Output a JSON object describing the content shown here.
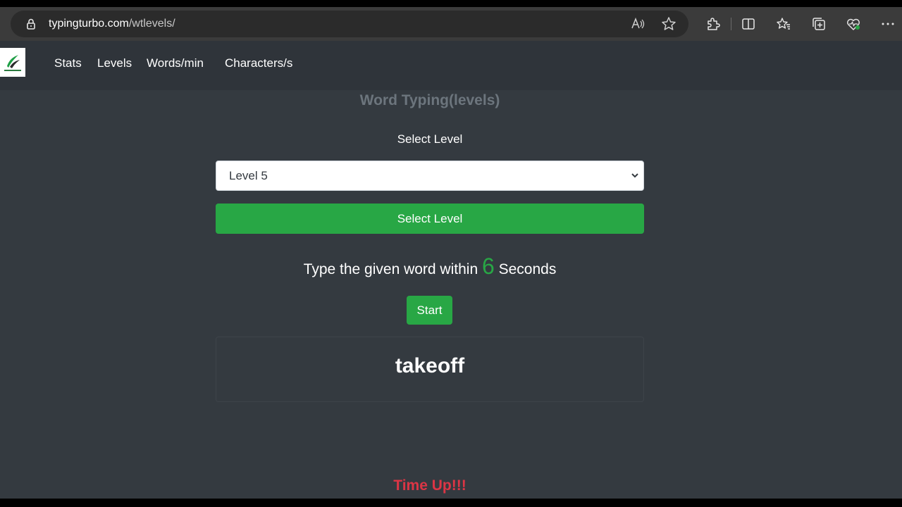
{
  "browser": {
    "url_host": "typingturbo.com",
    "url_path": "/wtlevels/",
    "icons": [
      "lock-icon",
      "read-aloud-icon",
      "favorite-star-icon",
      "extensions-icon",
      "split-screen-icon",
      "favorites-icon",
      "collections-icon",
      "browser-essentials-icon",
      "more-menu-icon"
    ]
  },
  "nav": {
    "items": [
      {
        "label": "Stats"
      },
      {
        "label": "Levels"
      },
      {
        "label": "Words/min"
      },
      {
        "label": "Characters/s"
      }
    ]
  },
  "main": {
    "heading": "Word Typing(levels)",
    "select_title": "Select Level",
    "selected_level": "Level 5",
    "select_button": "Select Level",
    "instruction_prefix": "Type the given word within",
    "seconds": "6",
    "instruction_suffix": "Seconds",
    "start_button": "Start",
    "word": "takeoff",
    "status": "Time Up!!!"
  },
  "colors": {
    "page_bg": "#343a40",
    "navbar_bg": "#2f343a",
    "accent_green": "#28a745",
    "heading_gray": "#6c757d",
    "status_red": "#dc3545"
  }
}
